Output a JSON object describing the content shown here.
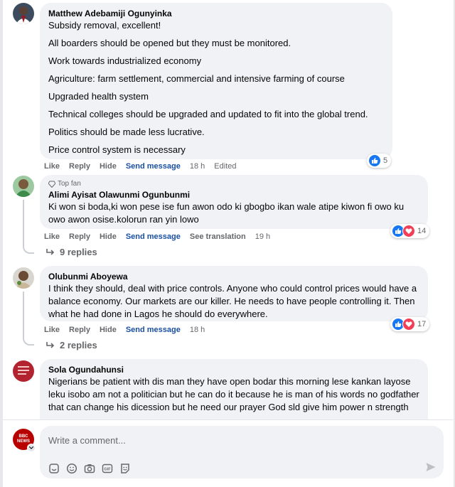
{
  "comments": [
    {
      "author": "Matthew Adebamiji Ogunyinka",
      "paragraphs": [
        "Subsidy removal, excellent!",
        "All boarders should be opened but they must be monitored.",
        "Work towards industrialized economy",
        "Agriculture: farm settlement, commercial and intensive farming of course",
        "Upgraded health system",
        "Technical colleges should be upgraded and updated to fit into the global trend.",
        "Politics should be made less lucrative.",
        "Price control system is necessary"
      ],
      "actions": {
        "like": "Like",
        "reply": "Reply",
        "hide": "Hide",
        "send": "Send message",
        "time": "18 h",
        "edited": "Edited"
      },
      "reactions": "5"
    },
    {
      "badge": "Top fan",
      "author": "Alimi Ayisat Olawunmi Ogunbunmi",
      "text": "Ki won si boda,ki won pese ise fun awon odo ki gbogbo ikan wale atipe kiwon fi owo ku owo awon osise.kolorun ran yin lowo",
      "actions": {
        "like": "Like",
        "reply": "Reply",
        "hide": "Hide",
        "send": "Send message",
        "translate": "See translation",
        "time": "19 h"
      },
      "reactions": "14",
      "replies": "9 replies"
    },
    {
      "author": "Olubunmi Aboyewa",
      "text": "I think they should, deal with price controls. Anyone who could control prices would have a balance economy. Our markets are our killer. He needs to have people controlling it. Then what he had done in Lagos he should do everywhere.",
      "actions": {
        "like": "Like",
        "reply": "Reply",
        "hide": "Hide",
        "send": "Send message",
        "time": "18 h"
      },
      "reactions": "17",
      "replies": "2 replies"
    },
    {
      "author": "Sola Ogundahunsi",
      "text": "Nigerians be patient with dis man they have open bodar this morning lese kankan layose leku isobo am not a politician but he can do it because he is man of his words no godfather that can change his dicession but he need our prayer God sld give him power n strength"
    }
  ],
  "composer": {
    "placeholder": "Write a comment...",
    "avatar_text": "BBC NEWS",
    "tools": [
      "sticker-icon",
      "emoji-icon",
      "camera-icon",
      "gif-icon",
      "avatar-sticker-icon"
    ]
  },
  "colors": {
    "link_blue": "#1a4fa3",
    "bubble": "#f0f2f5",
    "like": "#1877f2",
    "love": "#f33e58",
    "bbc_red": "#b80000"
  }
}
